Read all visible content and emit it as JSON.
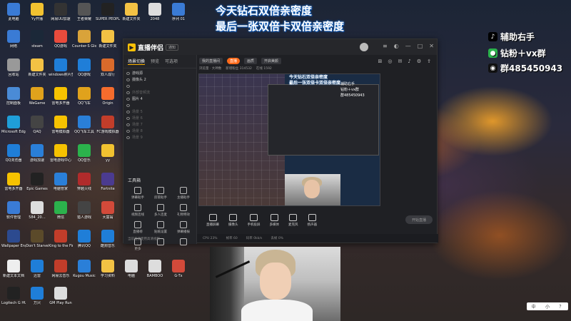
{
  "overlay": {
    "line1": "今天钻石双倍亲密度",
    "line2": "最后一张双倍卡双倍亲密度",
    "social": {
      "tiktok": "辅助右手",
      "wechat": "钻粉＋vx群",
      "qq": "群485450943"
    }
  },
  "colors": {
    "accent": "#ffb400",
    "live": "#ff6a1a",
    "overlay_glow": "#1565c0"
  },
  "desktop_icons": [
    {
      "label": "此电脑",
      "icon": "pc-icon",
      "color": "#3a7bd5"
    },
    {
      "label": "Yy开播",
      "icon": "yy-icon",
      "color": "#f2c230"
    },
    {
      "label": "网易UU加速",
      "icon": "uu-icon",
      "color": "#333"
    },
    {
      "label": "王者荣耀",
      "icon": "game-icon",
      "color": "#555"
    },
    {
      "label": "SUPER PEOPLE CBT",
      "icon": "game-icon",
      "color": "#222"
    },
    {
      "label": "新建文件夹",
      "icon": "folder-icon",
      "color": "#f3c244"
    },
    {
      "label": "2048",
      "icon": "file-icon",
      "color": "#ddd"
    },
    {
      "label": "序列 01",
      "icon": "video-icon",
      "color": "#3a7bd5"
    },
    {
      "label": "网络",
      "icon": "network-icon",
      "color": "#3a7bd5"
    },
    {
      "label": "steam",
      "icon": "steam-icon",
      "color": "#1b2838"
    },
    {
      "label": "QQ游戏",
      "icon": "qqgame-icon",
      "color": "#e94b3c"
    },
    {
      "label": "Counter-S Global Off",
      "icon": "csgo-icon",
      "color": "#d9a33a"
    },
    {
      "label": "新建文件夹",
      "icon": "folder-icon",
      "color": "#f3c244"
    },
    {
      "label": "回收站",
      "icon": "trash-icon",
      "color": "#999"
    },
    {
      "label": "新建文件夹",
      "icon": "folder-icon",
      "color": "#f3c244"
    },
    {
      "label": "windows照片查看器",
      "icon": "photo-icon",
      "color": "#1f7ed8"
    },
    {
      "label": "QQ游戏",
      "icon": "qqgame-icon",
      "color": "#1f7ed8"
    },
    {
      "label": "双人成行",
      "icon": "game-icon",
      "color": "#d96a2b"
    },
    {
      "label": "控制面板",
      "icon": "panel-icon",
      "color": "#4a8bd6"
    },
    {
      "label": "WeGame",
      "icon": "wegame-icon",
      "color": "#e0a21c"
    },
    {
      "label": "雷电多开器",
      "icon": "ld-icon",
      "color": "#f6c200"
    },
    {
      "label": "QQ飞车",
      "icon": "qqcar-icon",
      "color": "#e0a21c"
    },
    {
      "label": "Origin",
      "icon": "origin-icon",
      "color": "#f56c2d"
    },
    {
      "label": "Microsoft Edge",
      "icon": "edge-icon",
      "color": "#1f9ed8"
    },
    {
      "label": "QAQ",
      "icon": "file-icon",
      "color": "#444"
    },
    {
      "label": "雷电模拟器",
      "icon": "ld-icon",
      "color": "#f6c200"
    },
    {
      "label": "QQ飞车工具",
      "icon": "qqcar-icon",
      "color": "#2a7fd8"
    },
    {
      "label": "FC游戏模拟器",
      "icon": "game-icon",
      "color": "#c23d2a"
    },
    {
      "label": "QQ浏览器",
      "icon": "qqbrowser-icon",
      "color": "#1f7ed8"
    },
    {
      "label": "游戏加速",
      "icon": "speed-icon",
      "color": "#2a7fd8"
    },
    {
      "label": "雷电游戏中心",
      "icon": "ld-icon",
      "color": "#f6c200"
    },
    {
      "label": "QQ音乐",
      "icon": "music-icon",
      "color": "#2bb24c"
    },
    {
      "label": "yy",
      "icon": "yy-icon",
      "color": "#f2c230"
    },
    {
      "label": "雷电多开器",
      "icon": "ld-icon",
      "color": "#f6c200"
    },
    {
      "label": "Epic Games",
      "icon": "epic-icon",
      "color": "#222"
    },
    {
      "label": "电脑管家",
      "icon": "shield-icon",
      "color": "#2a7fd8"
    },
    {
      "label": "穿越火线",
      "icon": "cf-icon",
      "color": "#b02b2b"
    },
    {
      "label": "Fortnite",
      "icon": "game-icon",
      "color": "#4b3b8f"
    },
    {
      "label": "软件管理",
      "icon": "apps-icon",
      "color": "#3a7bd5"
    },
    {
      "label": "584_20…",
      "icon": "file-icon",
      "color": "#ddd"
    },
    {
      "label": "微信",
      "icon": "wechat-icon",
      "color": "#2bb24c"
    },
    {
      "label": "猎人游戏",
      "icon": "game-icon",
      "color": "#444"
    },
    {
      "label": "大富翁",
      "icon": "game-icon",
      "color": "#d24a3a"
    },
    {
      "label": "Wallpaper Engine",
      "icon": "wallpaper-icon",
      "color": "#2c4a8f"
    },
    {
      "label": "Don't Starve",
      "icon": "game-icon",
      "color": "#5b4a2a"
    },
    {
      "label": "King to the Finish",
      "icon": "game-icon",
      "color": "#c23d2a"
    },
    {
      "label": "腾讯QQ",
      "icon": "qq-icon",
      "color": "#1f7ed8"
    },
    {
      "label": "酷狗音乐",
      "icon": "kugou-icon",
      "color": "#1f7ed8"
    },
    {
      "label": "新建文本文档",
      "icon": "txt-icon",
      "color": "#eee"
    },
    {
      "label": "迅雷",
      "icon": "xunlei-icon",
      "color": "#1f7ed8"
    },
    {
      "label": "网易云音乐",
      "icon": "music-icon",
      "color": "#c23d2a"
    },
    {
      "label": "Kugou Music",
      "icon": "kugou-icon",
      "color": "#2a7fd8"
    },
    {
      "label": "学习资料",
      "icon": "folder-icon",
      "color": "#f3c244"
    },
    {
      "label": "电脑",
      "icon": "file-icon",
      "color": "#ddd"
    },
    {
      "label": "BAMBOO",
      "icon": "file-icon",
      "color": "#ddd"
    },
    {
      "label": "G-Tx",
      "icon": "game-icon",
      "color": "#d24a3a"
    },
    {
      "label": "Logitech G HUB",
      "icon": "ghub-icon",
      "color": "#222"
    },
    {
      "label": "万兴",
      "icon": "app-icon",
      "color": "#1f7ed8"
    },
    {
      "label": "GM Play Run",
      "icon": "file-icon",
      "color": "#ddd"
    }
  ],
  "app": {
    "logo": "直播伴侣",
    "titlebar_menu": "通知",
    "side_tabs": [
      "场景切换",
      "预览",
      "可选项"
    ],
    "scenes": [
      {
        "label": "游戏源",
        "dim": false
      },
      {
        "label": "摄像头 2",
        "dim": false
      },
      {
        "label": "",
        "dim": false
      },
      {
        "label": "外部音频流",
        "dim": true
      },
      {
        "label": "图片 4",
        "dim": false
      },
      {
        "label": "",
        "dim": false
      },
      {
        "label": "场景 5",
        "dim": true
      },
      {
        "label": "场景 6",
        "dim": true
      },
      {
        "label": "场景 7",
        "dim": true
      },
      {
        "label": "场景 8",
        "dim": true
      },
      {
        "label": "场景 9",
        "dim": true
      }
    ],
    "tools_header": "工具箱",
    "tools": [
      "弹幕助手",
      "房管助手",
      "主播助手",
      "视频连线",
      "多人连麦",
      "礼物特效",
      "直播榜",
      "贴纸设置",
      "弹幕播报",
      "更多",
      "",
      ""
    ],
    "side_footer": "当前直播使用高清视频",
    "top_bar": {
      "room": "我的直播间",
      "live_badge": "直播",
      "chip1": "画质",
      "chip2": "开启美颜"
    },
    "info_bar": [
      "浏览量 · 大神数",
      "新增粉丝 314532",
      "在线 1592"
    ],
    "controls": [
      "直播屏幕",
      "摄像头",
      "手机投屏",
      "多媒体",
      "麦克风",
      "扬声器"
    ],
    "start_button": "开始直播",
    "status": [
      "CPU 23%",
      "帧率 60",
      "码率 0kb/s",
      "丢帧 0%"
    ],
    "preview_inner_text": [
      "今天钻石双倍亲密度",
      "最后一张双倍卡双倍亲密度"
    ],
    "preview_social": [
      "辅助右手",
      "钻粉＋vx群",
      "群485450943"
    ]
  },
  "tray": [
    "中",
    "小",
    "？"
  ]
}
